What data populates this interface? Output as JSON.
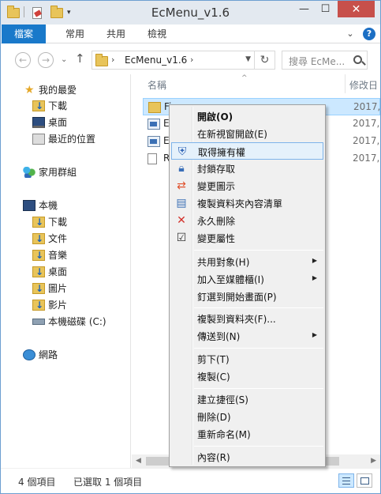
{
  "window": {
    "title": "EcMenu_v1.6",
    "controls": {
      "minimize": "—",
      "maximize": "☐",
      "close": "✕"
    }
  },
  "ribbon": {
    "tabs": [
      "檔案",
      "常用",
      "共用",
      "檢視"
    ],
    "help": "?"
  },
  "nav": {
    "back": "←",
    "forward": "→",
    "up": "↑",
    "address": "EcMenu_v1.6",
    "search_placeholder": "搜尋 EcMe...",
    "refresh": "↻"
  },
  "sidebar": {
    "favorites": {
      "label": "我的最愛",
      "items": [
        "下載",
        "桌面",
        "最近的位置"
      ]
    },
    "homegroup": "家用群組",
    "thispc": {
      "label": "本機",
      "items": [
        "下載",
        "文件",
        "音樂",
        "桌面",
        "圖片",
        "影片",
        "本機磁碟 (C:)"
      ]
    },
    "network": "網路"
  },
  "list": {
    "columns": {
      "name": "名稱",
      "date": "修改日"
    },
    "rows": [
      {
        "name": "Fi",
        "date": "2017,"
      },
      {
        "name": "E",
        "date": "2017,"
      },
      {
        "name": "E",
        "date": "2017,"
      },
      {
        "name": "R",
        "date": "2017,"
      }
    ]
  },
  "context_menu": {
    "open": "開啟(O)",
    "open_new_window": "在新視窗開啟(E)",
    "take_ownership": "取得擁有權",
    "lock_access": "封鎖存取",
    "change_icon": "變更圖示",
    "copy_contents_list": "複製資料夾內容清單",
    "delete_permanently": "永久刪除",
    "change_attributes": "變更屬性",
    "share_with": "共用對象(H)",
    "add_to_library": "加入至媒體櫃(I)",
    "pin_to_start": "釘選到開始畫面(P)",
    "copy_to_folder": "複製到資料夾(F)...",
    "send_to": "傳送到(N)",
    "cut": "剪下(T)",
    "copy": "複製(C)",
    "create_shortcut": "建立捷徑(S)",
    "delete": "刪除(D)",
    "rename": "重新命名(M)",
    "properties": "內容(R)"
  },
  "status": {
    "items": "4 個項目",
    "selected": "已選取 1 個項目"
  },
  "colors": {
    "file_tab": "#1979ca",
    "selection": "#cce8ff",
    "menu_highlight": "#e5f1fb",
    "close_button": "#c7504b"
  }
}
